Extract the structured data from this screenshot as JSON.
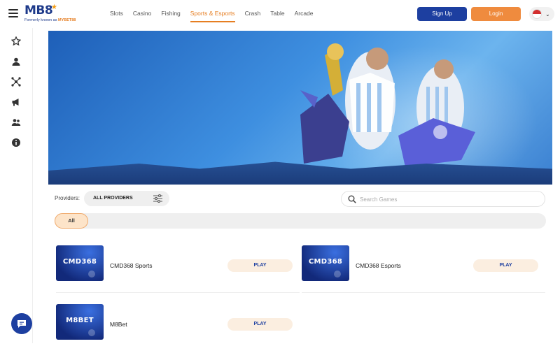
{
  "header": {
    "logo_text": "MB8",
    "logo_tagline_prefix": "Formerly known as",
    "logo_tagline_brand": "MYBET88",
    "nav": [
      "Slots",
      "Casino",
      "Fishing",
      "Sports & Esports",
      "Crash",
      "Table",
      "Arcade"
    ],
    "active_nav": "Sports & Esports",
    "signup_label": "Sign Up",
    "login_label": "Login",
    "language_flag": "singapore-flag-icon"
  },
  "sidebar": {
    "icons": [
      "star-icon",
      "user-icon",
      "referral-icon",
      "megaphone-icon",
      "friends-icon",
      "info-icon"
    ],
    "chat_icon": "chat-icon"
  },
  "colors": {
    "brand_blue": "#1d3fa0",
    "accent_orange": "#ef8b3e",
    "active_nav": "#e67e22"
  },
  "filters": {
    "providers_label": "Providers:",
    "providers_value": "ALL PROVIDERS",
    "search_placeholder": "Search Games",
    "categories": [
      "All"
    ]
  },
  "games": [
    {
      "thumb": "CMD368",
      "name": "CMD368 Sports",
      "play": "PLAY"
    },
    {
      "thumb": "CMD368",
      "name": "CMD368 Esports",
      "play": "PLAY"
    },
    {
      "thumb": "M8BET",
      "name": "M8Bet",
      "play": "PLAY"
    }
  ]
}
